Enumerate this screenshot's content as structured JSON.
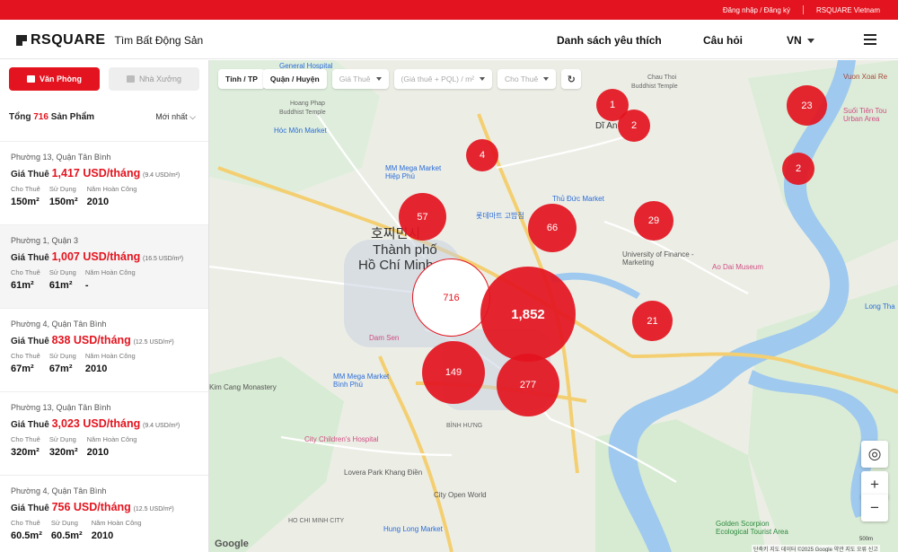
{
  "topbar": {
    "login": "Đăng nhập / Đăng ký",
    "region": "RSQUARE Vietnam"
  },
  "header": {
    "logo": "RSQUARE",
    "subtitle": "Tìm Bất Động Sản",
    "nav": [
      "Danh sách yêu thích",
      "Câu hỏi"
    ],
    "lang": "VN"
  },
  "sidebar": {
    "tabs": [
      {
        "label": "Văn Phòng",
        "active": true
      },
      {
        "label": "Nhà Xưởng",
        "active": false
      }
    ],
    "total_prefix": "Tổng",
    "total_count": "716",
    "total_suffix": "Sản Phẩm",
    "sort": "Mới nhất",
    "spec_labels": [
      "Cho Thuê",
      "Sử Dụng",
      "Năm Hoàn Công"
    ],
    "price_label": "Giá Thuê",
    "listings": [
      {
        "location": "Phường 13, Quận Tân Bình",
        "price": "1,417 USD/tháng",
        "unit": "(9.4 USD/m²)",
        "rent_area": "150m²",
        "use_area": "150m²",
        "year": "2010",
        "highlight": false
      },
      {
        "location": "Phường 1, Quận 3",
        "price": "1,007 USD/tháng",
        "unit": "(16.5 USD/m²)",
        "rent_area": "61m²",
        "use_area": "61m²",
        "year": "-",
        "highlight": true
      },
      {
        "location": "Phường 4, Quận Tân Bình",
        "price": "838 USD/tháng",
        "unit": "(12.5 USD/m²)",
        "rent_area": "67m²",
        "use_area": "67m²",
        "year": "2010",
        "highlight": false
      },
      {
        "location": "Phường 13, Quận Tân Bình",
        "price": "3,023 USD/tháng",
        "unit": "(9.4 USD/m²)",
        "rent_area": "320m²",
        "use_area": "320m²",
        "year": "2010",
        "highlight": false
      },
      {
        "location": "Phường 4, Quận Tân Bình",
        "price": "756 USD/tháng",
        "unit": "(12.5 USD/m²)",
        "rent_area": "60.5m²",
        "use_area": "60.5m²",
        "year": "2010",
        "highlight": false
      }
    ]
  },
  "map": {
    "filters": [
      {
        "label": "Tỉnh / TP",
        "dropdown": false,
        "dim": false
      },
      {
        "label": "Quận / Huyện",
        "dropdown": false,
        "dim": false
      },
      {
        "label": "Giá Thuê",
        "dropdown": true,
        "dim": true
      },
      {
        "label": "(Giá thuê + PQL) / m²",
        "dropdown": true,
        "dim": true
      },
      {
        "label": "Cho Thuê",
        "dropdown": true,
        "dim": true
      }
    ],
    "clusters": [
      {
        "count": "1"
      },
      {
        "count": "2"
      },
      {
        "count": "23"
      },
      {
        "count": "4"
      },
      {
        "count": "2"
      },
      {
        "count": "57"
      },
      {
        "count": "66"
      },
      {
        "count": "29"
      },
      {
        "count": "716",
        "selected": true
      },
      {
        "count": "1,852"
      },
      {
        "count": "21"
      },
      {
        "count": "149"
      },
      {
        "count": "277"
      }
    ],
    "labels": {
      "city_ko": "호찌민시",
      "city_vi_1": "Thành phố",
      "city_vi_2": "Hồ Chí Minh",
      "general_hospital": "General Hospital",
      "hoang_phap": "Hoang Phap",
      "buddhist_temple": "Buddhist Temple",
      "hoc_mon_market": "Hóc Môn Market",
      "mm_mega_hiep_phu": "MM Mega Market Hiệp Phú",
      "mm_mega_binh_phu": "MM Mega Market Bình Phú",
      "thu_duc_market": "Thủ Đức Market",
      "lotte_mart": "롯데마트 고밥점",
      "chau_thoi": "Chau Thoi",
      "buddhist_temple_2": "Buddhist Temple",
      "di_an": "Dĩ An",
      "vuon_xoai": "Vuon Xoai Re",
      "suoi_tien": "Suối Tiên Tou Urban Area",
      "university_finance": "University of Finance - Marketing",
      "ao_dai": "Ao Dai Museum",
      "long_thanh": "Long Tha",
      "kim_cang": "Kim Cang Monastery",
      "city_childrens": "City Children's Hospital",
      "lovera": "Lovera Park Khang Điền",
      "city_open_world": "City Open World",
      "hung_long": "Hung Long Market",
      "golden_scorpion": "Golden Scorpion Ecological Tourist Area",
      "dam_sen": "Dam Sen",
      "binh_hung": "BÌNH HƯNG",
      "hcmc_road": "HO CHI MINH CITY"
    },
    "google": "Google",
    "attribution": "단축키  지도 데이터 ©2025 Google  약관  지도 오류 신고",
    "scale": "500m",
    "zoom_in": "+",
    "zoom_out": "−"
  }
}
